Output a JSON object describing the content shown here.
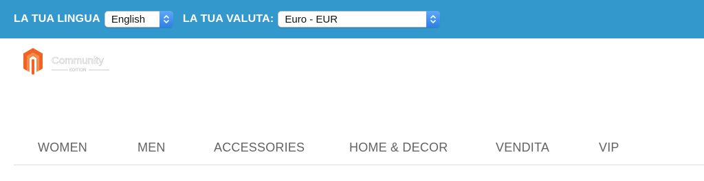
{
  "topbar": {
    "language_label": "LA TUA LINGUA",
    "language_value": "English",
    "currency_label": "LA TUA VALUTA:",
    "currency_value": "Euro - EUR"
  },
  "logo": {
    "text_main": "Community",
    "text_sub": "EDITION"
  },
  "nav": {
    "items": [
      {
        "label": "WOMEN"
      },
      {
        "label": "MEN"
      },
      {
        "label": "ACCESSORIES"
      },
      {
        "label": "HOME & DECOR"
      },
      {
        "label": "VENDITA"
      },
      {
        "label": "VIP"
      }
    ]
  },
  "colors": {
    "topbar_bg": "#3399cc",
    "logo_orange": "#f26322",
    "nav_text": "#636363"
  }
}
